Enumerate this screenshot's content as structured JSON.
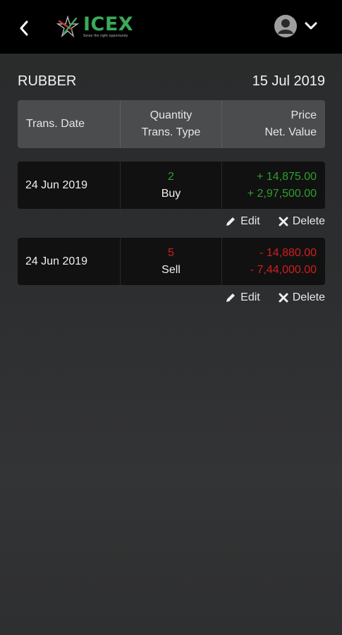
{
  "header": {
    "logo_name": "ICEX",
    "logo_tagline": "Seize the right opportunity"
  },
  "title": {
    "commodity": "RUBBER",
    "date": "15 Jul 2019"
  },
  "table_header": {
    "col1": "Trans. Date",
    "col2_line1": "Quantity",
    "col2_line2": "Trans. Type",
    "col3_line1": "Price",
    "col3_line2": "Net. Value"
  },
  "transactions": [
    {
      "date": "24 Jun 2019",
      "quantity": "2",
      "type": "Buy",
      "price": "+ 14,875.00",
      "net_value": "+ 2,97,500.00",
      "color": "#2f9e2f"
    },
    {
      "date": "24 Jun 2019",
      "quantity": "5",
      "type": "Sell",
      "price": "- 14,880.00",
      "net_value": "- 7,44,000.00",
      "color": "#d11e1e"
    }
  ],
  "actions": {
    "edit_label": "Edit",
    "delete_label": "Delete"
  },
  "icons": {
    "back": "chevron-left-icon",
    "logo": "star-logo-icon",
    "profile": "user-avatar-icon",
    "menu": "chevron-down-icon",
    "edit": "pencil-icon",
    "delete": "close-icon"
  }
}
